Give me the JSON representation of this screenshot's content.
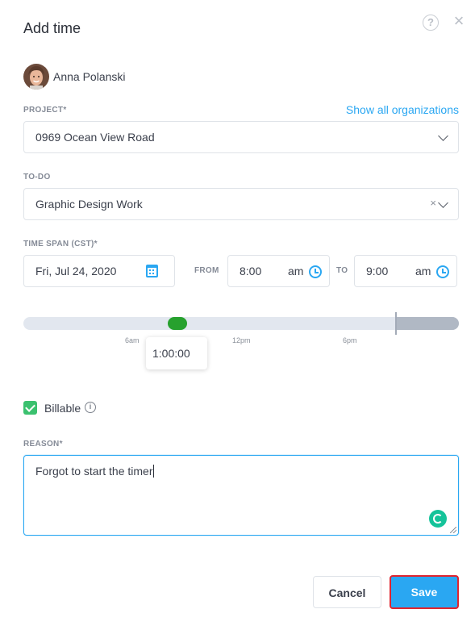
{
  "dialog": {
    "title": "Add time"
  },
  "user": {
    "name": "Anna Polanski"
  },
  "project": {
    "label": "PROJECT*",
    "show_all_link": "Show all organizations",
    "value": "0969 Ocean View Road"
  },
  "todo": {
    "label": "TO-DO",
    "value": "Graphic Design Work",
    "clear_symbol": "×"
  },
  "time_span": {
    "label": "TIME SPAN (CST)*",
    "date": "Fri, Jul 24, 2020",
    "from_label": "FROM",
    "from_time": "8:00",
    "from_ampm": "am",
    "to_label": "TO",
    "to_time": "9:00",
    "to_ampm": "am"
  },
  "timeline": {
    "ticks": [
      "6am",
      "12pm",
      "6pm"
    ],
    "duration": "1:00:00"
  },
  "billable": {
    "label": "Billable",
    "checked": true
  },
  "reason": {
    "label": "REASON*",
    "value": "Forgot to start the timer"
  },
  "buttons": {
    "cancel": "Cancel",
    "save": "Save"
  },
  "colors": {
    "accent": "#2aa7f2",
    "checkbox": "#3bc16f",
    "timeline_handle": "#27a12e",
    "save_outline": "#e0242f"
  }
}
